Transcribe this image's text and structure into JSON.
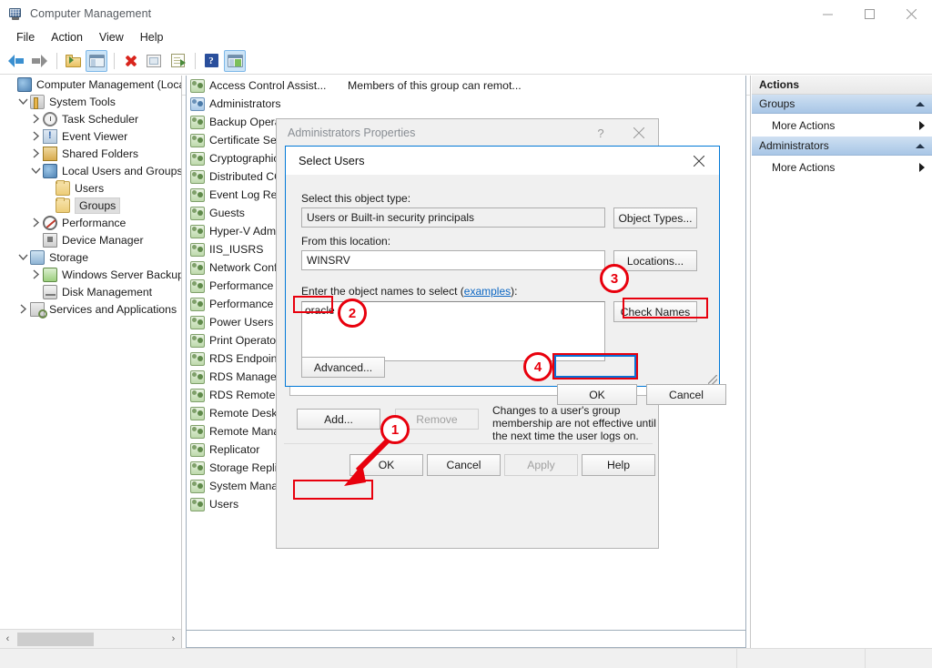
{
  "window": {
    "title": "Computer Management",
    "icon": "computer-management-icon",
    "minimize": "–",
    "maximize": "□",
    "close": "✕"
  },
  "menubar": {
    "items": [
      "File",
      "Action",
      "View",
      "Help"
    ]
  },
  "toolbar": {
    "items": [
      {
        "name": "back-icon",
        "kind": "back"
      },
      {
        "name": "forward-icon",
        "kind": "forward"
      },
      {
        "name": "up-one-level-icon",
        "kind": "folder-up"
      },
      {
        "name": "show-hide-console-tree-icon",
        "kind": "pane",
        "active": true
      },
      {
        "name": "delete-icon",
        "kind": "x"
      },
      {
        "name": "properties-icon",
        "kind": "doc"
      },
      {
        "name": "export-list-icon",
        "kind": "export"
      },
      {
        "name": "help-icon",
        "kind": "help"
      },
      {
        "name": "show-hide-action-pane-icon",
        "kind": "pane-green",
        "active": true
      }
    ]
  },
  "tree": {
    "items": [
      {
        "label": "Computer Management (Local",
        "depth": 0,
        "twisty": "none",
        "icon": "computer-icon",
        "selected": false
      },
      {
        "label": "System Tools",
        "depth": 1,
        "twisty": "expanded",
        "icon": "system-tools-icon",
        "selected": false
      },
      {
        "label": "Task Scheduler",
        "depth": 2,
        "twisty": "collapsed",
        "icon": "task-scheduler-icon",
        "selected": false
      },
      {
        "label": "Event Viewer",
        "depth": 2,
        "twisty": "collapsed",
        "icon": "event-viewer-icon",
        "selected": false
      },
      {
        "label": "Shared Folders",
        "depth": 2,
        "twisty": "collapsed",
        "icon": "shared-folders-icon",
        "selected": false
      },
      {
        "label": "Local Users and Groups",
        "depth": 2,
        "twisty": "expanded",
        "icon": "local-users-icon",
        "selected": false
      },
      {
        "label": "Users",
        "depth": 3,
        "twisty": "none",
        "icon": "folder-icon",
        "selected": false
      },
      {
        "label": "Groups",
        "depth": 3,
        "twisty": "none",
        "icon": "folder-icon",
        "selected": true
      },
      {
        "label": "Performance",
        "depth": 2,
        "twisty": "collapsed",
        "icon": "performance-icon",
        "selected": false
      },
      {
        "label": "Device Manager",
        "depth": 2,
        "twisty": "none",
        "icon": "device-manager-icon",
        "selected": false
      },
      {
        "label": "Storage",
        "depth": 1,
        "twisty": "expanded",
        "icon": "storage-icon",
        "selected": false
      },
      {
        "label": "Windows Server Backup",
        "depth": 2,
        "twisty": "collapsed",
        "icon": "backup-icon",
        "selected": false
      },
      {
        "label": "Disk Management",
        "depth": 2,
        "twisty": "none",
        "icon": "disk-management-icon",
        "selected": false
      },
      {
        "label": "Services and Applications",
        "depth": 1,
        "twisty": "collapsed",
        "icon": "services-icon",
        "selected": false
      }
    ],
    "scrollbar": {
      "left_arrow": "‹",
      "right_arrow": "›"
    }
  },
  "list": {
    "columns": [
      "Name",
      "Description",
      ""
    ],
    "rows": [
      {
        "name": "Access Control Assist...",
        "desc": "Members of this group can remot...",
        "selected": false
      },
      {
        "name": "Administrators",
        "desc": "",
        "selected": true
      },
      {
        "name": "Backup Operat",
        "desc": "",
        "selected": false
      },
      {
        "name": "Certificate Serv",
        "desc": "",
        "selected": false
      },
      {
        "name": "Cryptographic",
        "desc": "",
        "selected": false
      },
      {
        "name": "Distributed CO",
        "desc": "",
        "selected": false
      },
      {
        "name": "Event Log Rea",
        "desc": "",
        "selected": false
      },
      {
        "name": "Guests",
        "desc": "",
        "selected": false
      },
      {
        "name": "Hyper-V Admi",
        "desc": "",
        "selected": false
      },
      {
        "name": "IIS_IUSRS",
        "desc": "",
        "selected": false
      },
      {
        "name": "Network Confi",
        "desc": "",
        "selected": false
      },
      {
        "name": "Performance L",
        "desc": "",
        "selected": false
      },
      {
        "name": "Performance M",
        "desc": "",
        "selected": false
      },
      {
        "name": "Power Users",
        "desc": "",
        "selected": false
      },
      {
        "name": "Print Operator",
        "desc": "",
        "selected": false
      },
      {
        "name": "RDS Endpoint",
        "desc": "",
        "selected": false
      },
      {
        "name": "RDS Managem",
        "desc": "",
        "selected": false
      },
      {
        "name": "RDS Remote A",
        "desc": "",
        "selected": false
      },
      {
        "name": "Remote Deskt",
        "desc": "",
        "selected": false
      },
      {
        "name": "Remote Mana",
        "desc": "",
        "selected": false
      },
      {
        "name": "Replicator",
        "desc": "",
        "selected": false
      },
      {
        "name": "Storage Replic",
        "desc": "",
        "selected": false
      },
      {
        "name": "System Manag",
        "desc": "",
        "selected": false
      },
      {
        "name": "Users",
        "desc": "",
        "selected": false
      }
    ]
  },
  "actions": {
    "title": "Actions",
    "groups": [
      {
        "header": "Groups",
        "items": [
          "More Actions"
        ]
      },
      {
        "header": "Administrators",
        "items": [
          "More Actions"
        ]
      }
    ]
  },
  "properties_dialog": {
    "title": "Administrators Properties",
    "help_btn": "?",
    "close_btn": "✕",
    "add_button": "Add...",
    "remove_button": "Remove",
    "note": "Changes to a user's group membership are not effective until the next time the user logs on.",
    "footer_buttons": [
      "OK",
      "Cancel",
      "Apply",
      "Help"
    ]
  },
  "select_users_dialog": {
    "title": "Select Users",
    "close_btn": "✕",
    "object_type_label": "Select this object type:",
    "object_type_value": "Users or Built-in security principals",
    "object_types_button": "Object Types...",
    "location_label": "From this location:",
    "location_value": "WINSRV",
    "locations_button": "Locations...",
    "names_label_prefix": "Enter the object names to select (",
    "names_label_link": "examples",
    "names_label_suffix": "):",
    "names_value": "oracle",
    "check_names_button": "Check Names",
    "advanced_button": "Advanced...",
    "ok_button": "OK",
    "cancel_button": "Cancel"
  },
  "annotations": {
    "badges": [
      {
        "label": "1",
        "target": "add-button"
      },
      {
        "label": "2",
        "target": "object-names-input"
      },
      {
        "label": "3",
        "target": "check-names-button"
      },
      {
        "label": "4",
        "target": "select-users-ok-button"
      }
    ],
    "highlight_color": "#e8000d",
    "focus_color": "#0a6fd4"
  }
}
